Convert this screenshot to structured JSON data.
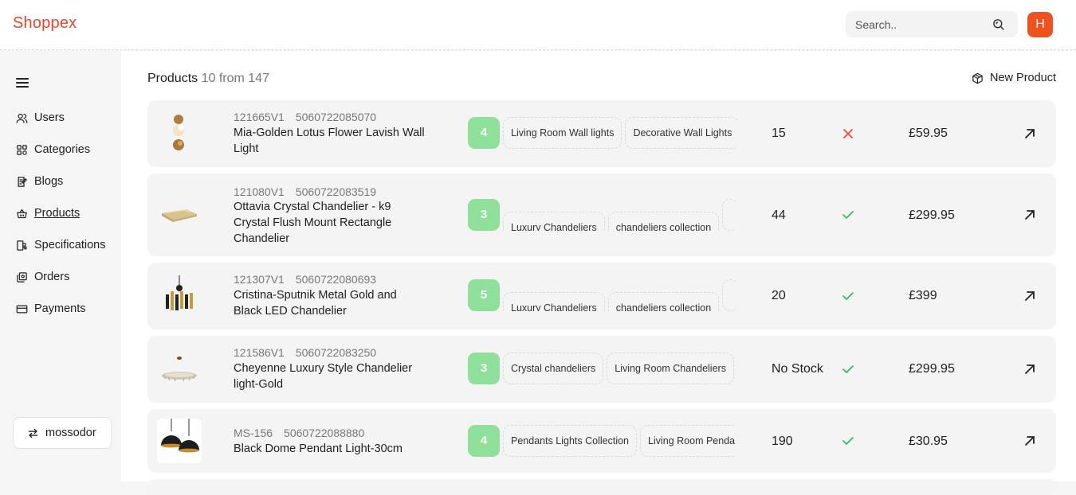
{
  "app": {
    "brand": "Shoppex",
    "avatar_initial": "H"
  },
  "search": {
    "placeholder": "Search.."
  },
  "sidebar": {
    "items": [
      {
        "label": "Users",
        "icon": "users-icon"
      },
      {
        "label": "Categories",
        "icon": "categories-icon"
      },
      {
        "label": "Blogs",
        "icon": "blogs-icon"
      },
      {
        "label": "Products",
        "icon": "basket-icon",
        "active": true
      },
      {
        "label": "Specifications",
        "icon": "specifications-icon"
      },
      {
        "label": "Orders",
        "icon": "orders-icon"
      },
      {
        "label": "Payments",
        "icon": "payments-icon"
      }
    ],
    "user": {
      "name": "mossodor",
      "icon": "switch-icon"
    }
  },
  "page": {
    "title": "Products",
    "count_text": "10 from 147",
    "new_product_label": "New Product"
  },
  "products": [
    {
      "sku": "121665V1",
      "barcode": "5060722085070",
      "name": "Mia-Golden Lotus Flower Lavish Wall Light",
      "category_count": "4",
      "tags": [
        "Living Room Wall lights",
        "Decorative Wall Lights"
      ],
      "stock": "15",
      "active": false,
      "price": "£59.95"
    },
    {
      "sku": "121080V1",
      "barcode": "5060722083519",
      "name": "Ottavia Crystal Chandelier - k9 Crystal Flush Mount Rectangle Chandelier",
      "category_count": "3",
      "tags": [
        "Luxury Chandeliers",
        "chandeliers collection",
        ""
      ],
      "stock": "44",
      "active": true,
      "price": "£299.95"
    },
    {
      "sku": "121307V1",
      "barcode": "5060722080693",
      "name": "Cristina-Sputnik Metal Gold and Black LED Chandelier",
      "category_count": "5",
      "tags": [
        "Luxury Chandeliers",
        "chandeliers collection",
        ""
      ],
      "stock": "20",
      "active": true,
      "price": "£399"
    },
    {
      "sku": "121586V1",
      "barcode": "5060722083250",
      "name": "Cheyenne Luxury Style Chandelier light-Gold",
      "category_count": "3",
      "tags": [
        "Crystal chandeliers",
        "Living Room Chandeliers"
      ],
      "stock": "No Stock",
      "active": true,
      "price": "£299.95"
    },
    {
      "sku": "MS-156",
      "barcode": "5060722088880",
      "name": "Black Dome Pendant Light-30cm",
      "category_count": "4",
      "tags": [
        "Pendants Lights Collection",
        "Living Room Pendants"
      ],
      "stock": "190",
      "active": true,
      "price": "£30.95"
    }
  ],
  "colors": {
    "brand": "#e8452b",
    "avatar": "#f0521f",
    "category_badge": "#8fe09a",
    "active_check": "#2fb85a",
    "inactive_x": "#e8452b"
  }
}
